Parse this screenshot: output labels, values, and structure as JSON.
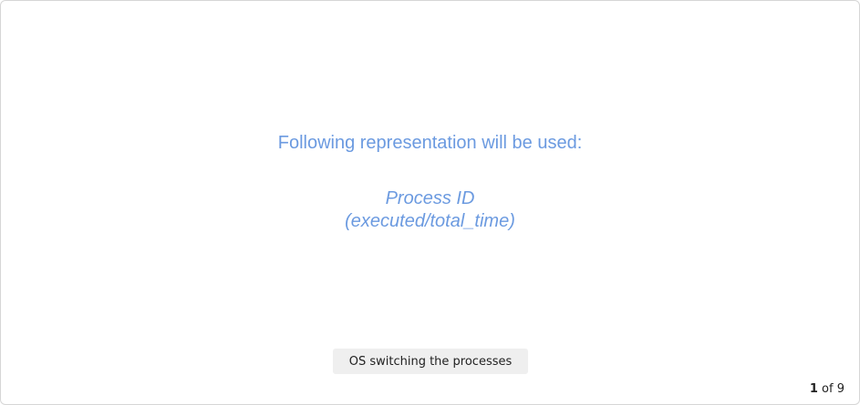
{
  "slide": {
    "heading": "Following representation will be used:",
    "representation": {
      "line1": "Process ID",
      "line2": "(executed/total_time)"
    },
    "accent_color": "#6b9ae0"
  },
  "controls": {
    "step_button_label": "OS switching the processes"
  },
  "pager": {
    "current": "1",
    "separator": "of",
    "total": "9"
  }
}
